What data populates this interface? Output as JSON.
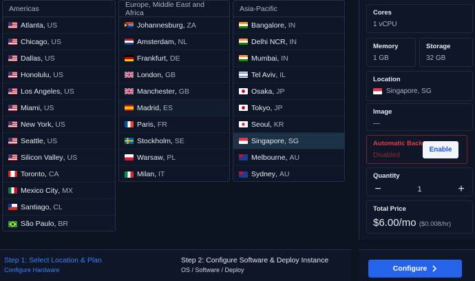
{
  "regions": [
    {
      "title": "Americas",
      "cities": [
        {
          "name": "Atlanta",
          "code": "US",
          "flag": "us-flag-icon"
        },
        {
          "name": "Chicago",
          "code": "US",
          "flag": "us-flag-icon"
        },
        {
          "name": "Dallas",
          "code": "US",
          "flag": "us-flag-icon"
        },
        {
          "name": "Honolulu",
          "code": "US",
          "flag": "us-flag-icon"
        },
        {
          "name": "Los Angeles",
          "code": "US",
          "flag": "us-flag-icon"
        },
        {
          "name": "Miami",
          "code": "US",
          "flag": "us-flag-icon"
        },
        {
          "name": "New York",
          "code": "US",
          "flag": "us-flag-icon"
        },
        {
          "name": "Seattle",
          "code": "US",
          "flag": "us-flag-icon"
        },
        {
          "name": "Silicon Valley",
          "code": "US",
          "flag": "us-flag-icon"
        },
        {
          "name": "Toronto",
          "code": "CA",
          "flag": "ca-flag-icon"
        },
        {
          "name": "Mexico City",
          "code": "MX",
          "flag": "mx-flag-icon"
        },
        {
          "name": "Santiago",
          "code": "CL",
          "flag": "cl-flag-icon"
        },
        {
          "name": "São Paulo",
          "code": "BR",
          "flag": "br-flag-icon"
        }
      ]
    },
    {
      "title": "Europe, Middle East and Africa",
      "cities": [
        {
          "name": "Johannesburg",
          "code": "ZA",
          "flag": "za-flag-icon"
        },
        {
          "name": "Amsterdam",
          "code": "NL",
          "flag": "nl-flag-icon"
        },
        {
          "name": "Frankfurt",
          "code": "DE",
          "flag": "de-flag-icon"
        },
        {
          "name": "London",
          "code": "GB",
          "flag": "gb-flag-icon"
        },
        {
          "name": "Manchester",
          "code": "GB",
          "flag": "gb-flag-icon"
        },
        {
          "name": "Madrid",
          "code": "ES",
          "flag": "es-flag-icon"
        },
        {
          "name": "Paris",
          "code": "FR",
          "flag": "fr-flag-icon"
        },
        {
          "name": "Stockholm",
          "code": "SE",
          "flag": "se-flag-icon"
        },
        {
          "name": "Warsaw",
          "code": "PL",
          "flag": "pl-flag-icon"
        },
        {
          "name": "Milan",
          "code": "IT",
          "flag": "it-flag-icon"
        }
      ]
    },
    {
      "title": "Asia-Pacific",
      "cities": [
        {
          "name": "Bangalore",
          "code": "IN",
          "flag": "in-flag-icon"
        },
        {
          "name": "Delhi NCR",
          "code": "IN",
          "flag": "in-flag-icon"
        },
        {
          "name": "Mumbai",
          "code": "IN",
          "flag": "in-flag-icon"
        },
        {
          "name": "Tel Aviv",
          "code": "IL",
          "flag": "il-flag-icon"
        },
        {
          "name": "Osaka",
          "code": "JP",
          "flag": "jp-flag-icon"
        },
        {
          "name": "Tokyo",
          "code": "JP",
          "flag": "jp-flag-icon"
        },
        {
          "name": "Seoul",
          "code": "KR",
          "flag": "kr-flag-icon"
        },
        {
          "name": "Singapore",
          "code": "SG",
          "flag": "sg-flag-icon"
        },
        {
          "name": "Melbourne",
          "code": "AU",
          "flag": "au-flag-icon"
        },
        {
          "name": "Sydney",
          "code": "AU",
          "flag": "au-flag-icon"
        }
      ]
    }
  ],
  "selected_location": "Singapore, SG",
  "summary": {
    "cores_label": "Cores",
    "cores_value": "1 vCPU",
    "memory_label": "Memory",
    "memory_value": "1 GB",
    "storage_label": "Storage",
    "storage_value": "32 GB",
    "location_label": "Location",
    "location_value": "Singapore, SG",
    "image_label": "Image",
    "image_value": "—",
    "backup_label": "Automatic Backup",
    "backup_status": "Disabled",
    "enable_label": "Enable",
    "quantity_label": "Quantity",
    "quantity_value": "1",
    "minus_symbol": "−",
    "plus_symbol": "+",
    "price_label": "Total Price",
    "price_value": "$6.00/mo",
    "price_hourly": "($0.008/hr)"
  },
  "steps": {
    "step1_title": "Step 1: Select Location & Plan",
    "step1_sub": "Configure Hardware",
    "step2_title": "Step 2: Configure Software & Deploy Instance",
    "step2_sub": "OS / Software / Deploy"
  },
  "configure_button": "Configure",
  "colors": {
    "accent": "#2563eb",
    "selected_row": "#1c3347",
    "danger": "#e0394d",
    "background": "#0b1220"
  }
}
